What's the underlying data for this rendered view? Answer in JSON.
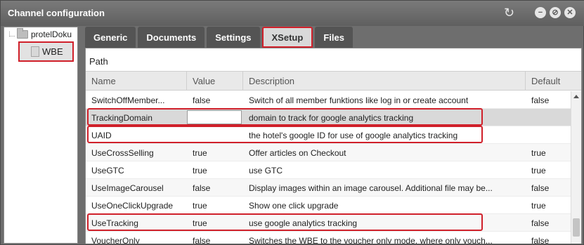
{
  "window": {
    "title": "Channel configuration"
  },
  "tree": [
    {
      "label": "protelDoku"
    },
    {
      "label": "WBE"
    }
  ],
  "tabs": [
    "Generic",
    "Documents",
    "Settings",
    "XSetup",
    "Files"
  ],
  "path_label": "Path",
  "columns": [
    "Name",
    "Value",
    "Description",
    "Default"
  ],
  "rows": [
    {
      "name": "SwitchOffMember...",
      "value": "false",
      "description": "Switch of all member funktions like log in or create account",
      "default": "false"
    },
    {
      "name": "TrackingDomain",
      "value": "",
      "description": "domain to track for google analytics tracking",
      "default": ""
    },
    {
      "name": "UAID",
      "value": "",
      "description": "the hotel's google ID for use of google analytics tracking",
      "default": ""
    },
    {
      "name": "UseCrossSelling",
      "value": "true",
      "description": "Offer articles on Checkout",
      "default": "true"
    },
    {
      "name": "UseGTC",
      "value": "true",
      "description": "use GTC",
      "default": "true"
    },
    {
      "name": "UseImageCarousel",
      "value": "false",
      "description": "Display images within an image carousel. Additional file may be...",
      "default": "false"
    },
    {
      "name": "UseOneClickUpgrade",
      "value": "true",
      "description": "Show one click upgrade",
      "default": "true"
    },
    {
      "name": "UseTracking",
      "value": "true",
      "description": "use google analytics tracking",
      "default": "false"
    },
    {
      "name": "VoucherOnly",
      "value": "false",
      "description": "Switches the WBE to the voucher only mode, where only vouch...",
      "default": "false"
    }
  ],
  "icons": {
    "refresh": "refresh-icon",
    "minimize": "minimize-icon",
    "maximize": "maximize-icon",
    "close": "close-icon",
    "folder": "folder-icon",
    "document": "document-icon"
  },
  "colors": {
    "highlight": "#d0202a",
    "tab_bg": "#545454",
    "titlebar": "#6e6e6e"
  }
}
